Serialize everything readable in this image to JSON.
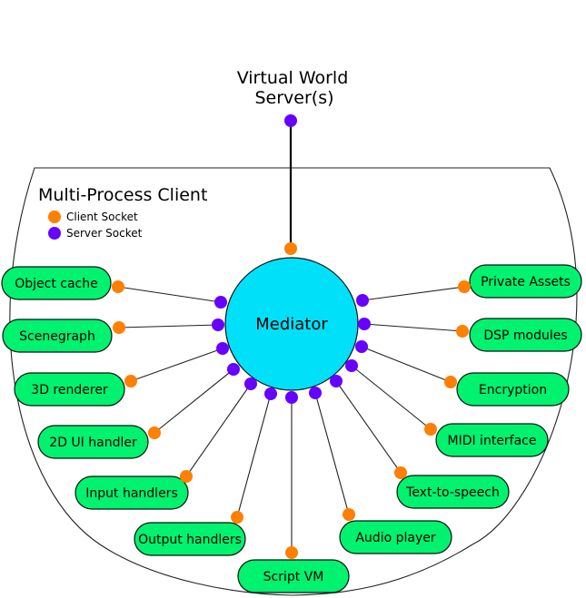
{
  "colors": {
    "client_socket": "#ff7f00",
    "server_socket": "#6600ff",
    "mediator_fill": "#00e1f9",
    "module_fill": "#00f26e"
  },
  "server": {
    "label_line1": "Virtual World",
    "label_line2": "Server(s)"
  },
  "client": {
    "title": "Multi-Process Client",
    "legend": [
      {
        "label": "Client Socket",
        "kind": "client"
      },
      {
        "label": "Server Socket",
        "kind": "server"
      }
    ]
  },
  "mediator": {
    "label": "Mediator"
  },
  "modules": {
    "left": [
      {
        "id": "object-cache",
        "label": "Object cache"
      },
      {
        "id": "scenegraph",
        "label": "Scenegraph"
      },
      {
        "id": "3d-renderer",
        "label": "3D renderer"
      },
      {
        "id": "2d-ui-handler",
        "label": "2D UI handler"
      },
      {
        "id": "input-handlers",
        "label": "Input handlers"
      },
      {
        "id": "output-handlers",
        "label": "Output handlers"
      }
    ],
    "bottom": [
      {
        "id": "script-vm",
        "label": "Script VM"
      }
    ],
    "right": [
      {
        "id": "private-assets",
        "label": "Private Assets"
      },
      {
        "id": "dsp-modules",
        "label": "DSP modules"
      },
      {
        "id": "encryption",
        "label": "Encryption"
      },
      {
        "id": "midi-interface",
        "label": "MIDI interface"
      },
      {
        "id": "text-to-speech",
        "label": "Text-to-speech"
      },
      {
        "id": "audio-player",
        "label": "Audio player"
      }
    ]
  }
}
